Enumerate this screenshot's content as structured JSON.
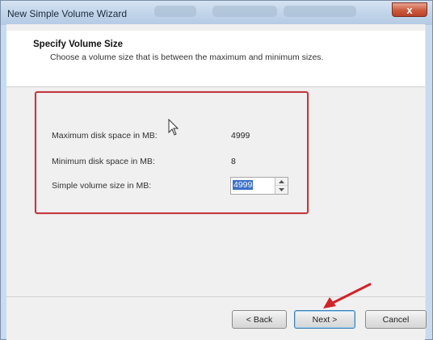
{
  "window": {
    "title": "New Simple Volume Wizard",
    "close_label": "x"
  },
  "header": {
    "title": "Specify Volume Size",
    "subtitle": "Choose a volume size that is between the maximum and minimum sizes."
  },
  "fields": {
    "max_label": "Maximum disk space in MB:",
    "max_value": "4999",
    "min_label": "Minimum disk space in MB:",
    "min_value": "8",
    "size_label": "Simple volume size in MB:",
    "size_value": "4999"
  },
  "buttons": {
    "back": "< Back",
    "next": "Next >",
    "cancel": "Cancel"
  },
  "colors": {
    "highlight": "#c4373f",
    "arrow": "#d2232a",
    "selection": "#3a6fc7"
  }
}
